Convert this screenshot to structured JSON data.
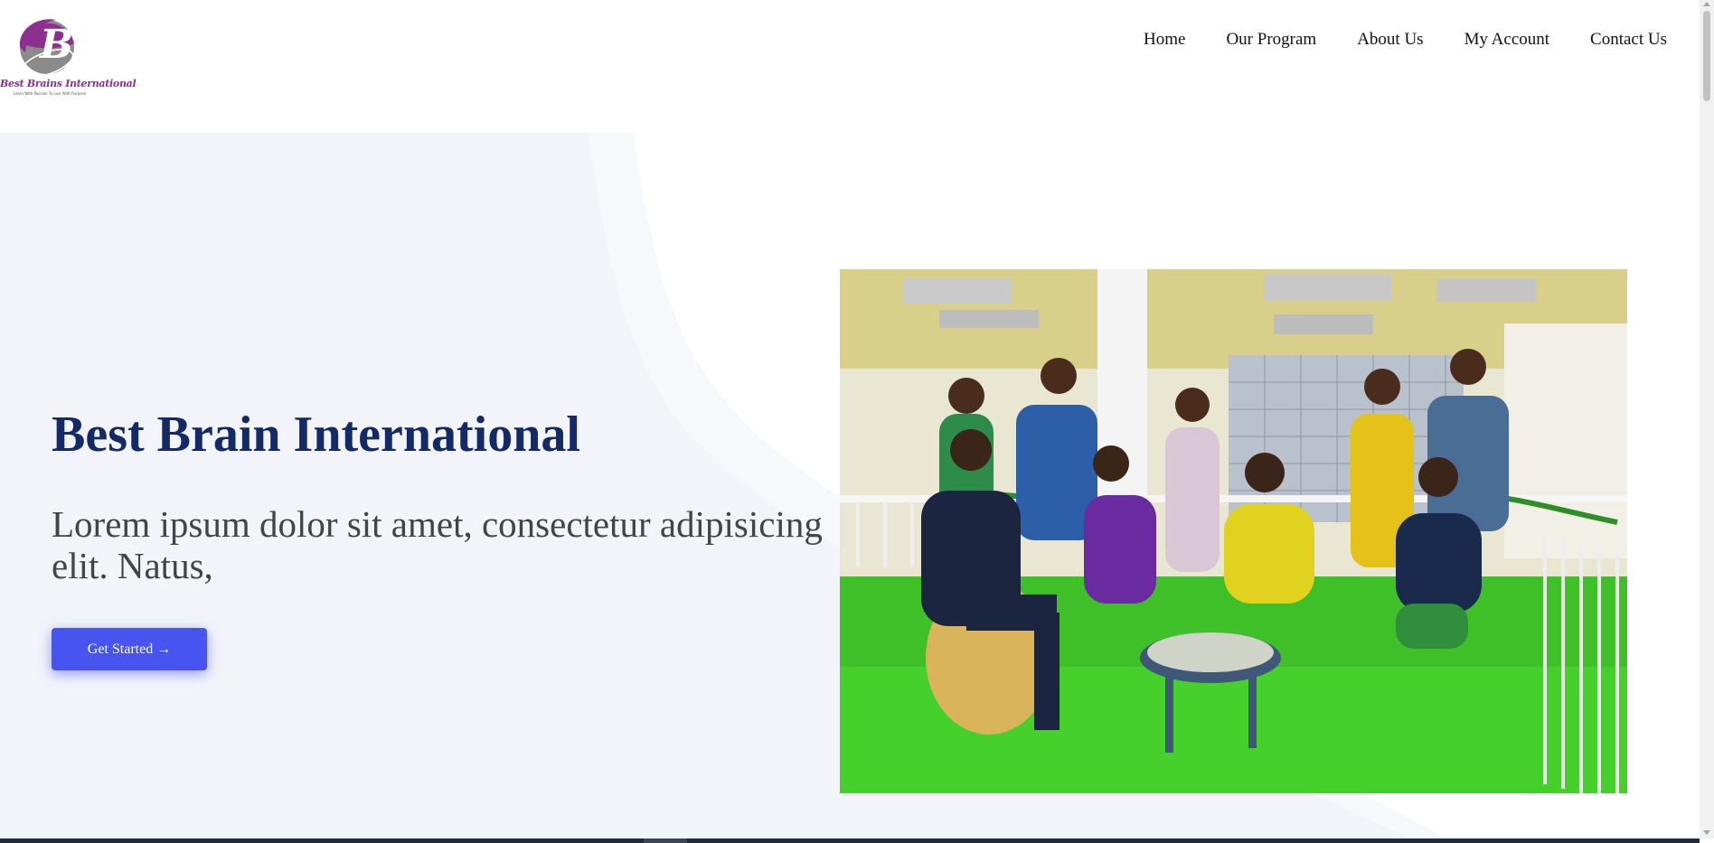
{
  "brand": {
    "name": "Best Brains International",
    "tagline": "Learn With Passion To Live With Purpose",
    "colors": {
      "logo_purple": "#8d2f8f",
      "logo_grey": "#8b8b8b"
    }
  },
  "nav": {
    "items": [
      {
        "label": "Home"
      },
      {
        "label": "Our Program"
      },
      {
        "label": "About Us"
      },
      {
        "label": "My Account"
      },
      {
        "label": "Contact Us"
      }
    ]
  },
  "hero": {
    "title": "Best Brain International",
    "subtitle": "Lorem ipsum dolor sit amet, consectetur adipisicing elit. Natus,",
    "cta_label": "Get Started →",
    "image": "group-photo",
    "colors": {
      "title": "#132a66",
      "background": "#f2f4fa",
      "cta": "#4754f0"
    }
  }
}
